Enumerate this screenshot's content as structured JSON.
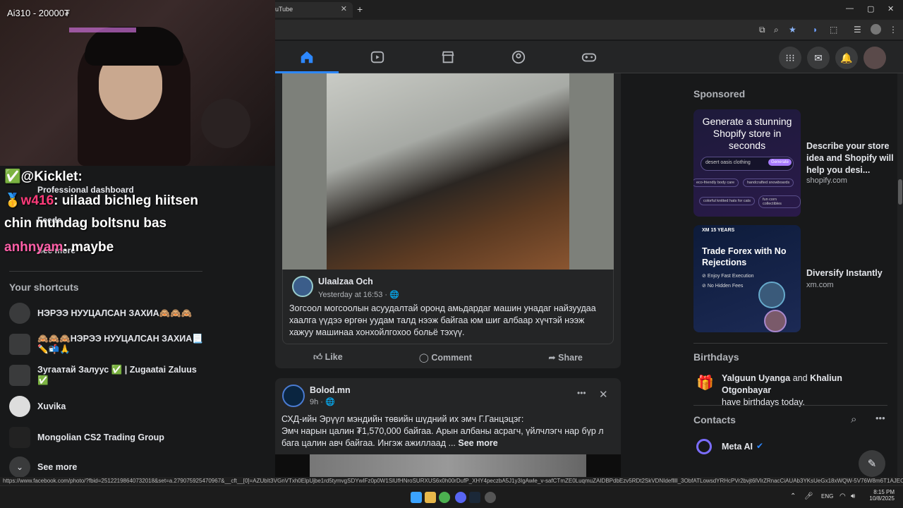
{
  "browser": {
    "tab_title": "uTube",
    "tab_close": "✕",
    "new_tab": "+",
    "window": {
      "minimize": "—",
      "maximize": "▢",
      "close": "✕"
    }
  },
  "stream_overlay": {
    "title": "Ai310 - 20000₮",
    "chat": [
      {
        "user": "@Kicklet",
        "sep": ":",
        "text": ""
      },
      {
        "user": "w416",
        "sep": ":",
        "text": "uilaad bichleg hiitsen"
      },
      {
        "user": "",
        "sep": "",
        "text": "chin mundag boltsnu bas"
      },
      {
        "user": "anhnyam",
        "sep": ":",
        "text": "maybe"
      }
    ]
  },
  "left_menu": {
    "professional_dashboard": "Professional dashboard",
    "feeds": "Feeds",
    "see_more_top": "See more",
    "shortcuts_title": "Your shortcuts",
    "shortcuts": [
      {
        "label": "НЭРЭЭ НУУЦАЛСАН ЗАХИА🙈🙈🙈",
        "icon": "group-avatar"
      },
      {
        "label": "🙈🙈🙈НЭРЭЭ НУУЦАЛСАН ЗАХИА📃✏️📬🙏",
        "icon": "group-avatar"
      },
      {
        "label": "Зугаатай Залуус ✅ | Zugaatai Zaluus ✅",
        "icon": "page-avatar"
      },
      {
        "label": "Xuvika",
        "icon": "user-avatar"
      },
      {
        "label": "Mongolian CS2 Trading Group",
        "icon": "group-avatar"
      }
    ],
    "see_more_bottom": "See more"
  },
  "post1": {
    "author": "Ulaalzaa Och",
    "time": "Yesterday at 16:53 · 🌐",
    "text": "Зогсоол могсоолын асуудалтай оронд амьдардаг машин унадаг найзуудаа хаалга үүдээ өргөн уудам талд нээж байгаа юм шиг албаар хүчтэй нээж хажуу машинаа хонхойлгохоо больё тэхүү.",
    "actions": {
      "like": "Like",
      "comment": "Comment",
      "share": "Share"
    }
  },
  "post2": {
    "author": "Bolod.mn",
    "time": "9h · 🌐",
    "line1": "СХД-ийн Эрүүл мэндийн төвийн шүдний их эмч Г.Ганцэцэг:",
    "line2": "Эмч нарын цалин ₮1,570,000 байгаа. Арын албаны асрагч, үйлчлэгч нар бүр л",
    "line3": "бага цалин авч байгаа. Ингэж ажиллаад ... ",
    "see_more": "See more",
    "more_icon": "•••",
    "close_icon": "✕"
  },
  "right_column": {
    "sponsored_title": "Sponsored",
    "ads": [
      {
        "creative_headline": "Generate a stunning Shopify store in seconds",
        "creative_input": "desert oasis clothing",
        "creative_button": "Generate",
        "creative_chips": [
          "eco-friendly body care",
          "handcrafted snowboards",
          "colorful knitted hats for cats",
          "fun corn collectibles"
        ],
        "title": "Describe your store idea and Shopify will help you desi...",
        "domain": "shopify.com"
      },
      {
        "creative_badge": "XM 15 YEARS",
        "creative_headline": "Trade Forex with No Rejections",
        "creative_bullets": [
          "Enjoy Fast Execution",
          "No Hidden Fees"
        ],
        "title": "Diversify Instantly",
        "domain": "xm.com"
      }
    ],
    "birthdays_title": "Birthdays",
    "birthday_name1": "Yalguun Uyanga",
    "birthday_and": " and ",
    "birthday_name2": "Khaliun Otgonbayar",
    "birthday_suffix": "have birthdays today.",
    "contacts_title": "Contacts",
    "contacts": [
      {
        "name": "Meta AI",
        "verified": true
      }
    ]
  },
  "status_url": "https://www.facebook.com/photo/?fbid=25122198640732018&set=a.279075925470967&__cft__[0]=AZUbIt3VGnVTxh0ElpUjbe1rd5tymvgSDYwIFz0p0W1SlUfHNroSURXUS6x0h00rDufP_XHY4peczbA5J1y3IgAwle_v-safCTmZE0LuqmuZAIDBPdbEzv5RDt2SkVDNIdefllll_3ObfATLowsdYRHcPVr2bvjt6lVlrZRnacCiAUAb3YKsUeGx18xWQW-5V76W8m6T1AJECk78...",
  "taskbar": {
    "lang": "ENG",
    "time": "8:15 PM",
    "date": "10/8/2025"
  }
}
